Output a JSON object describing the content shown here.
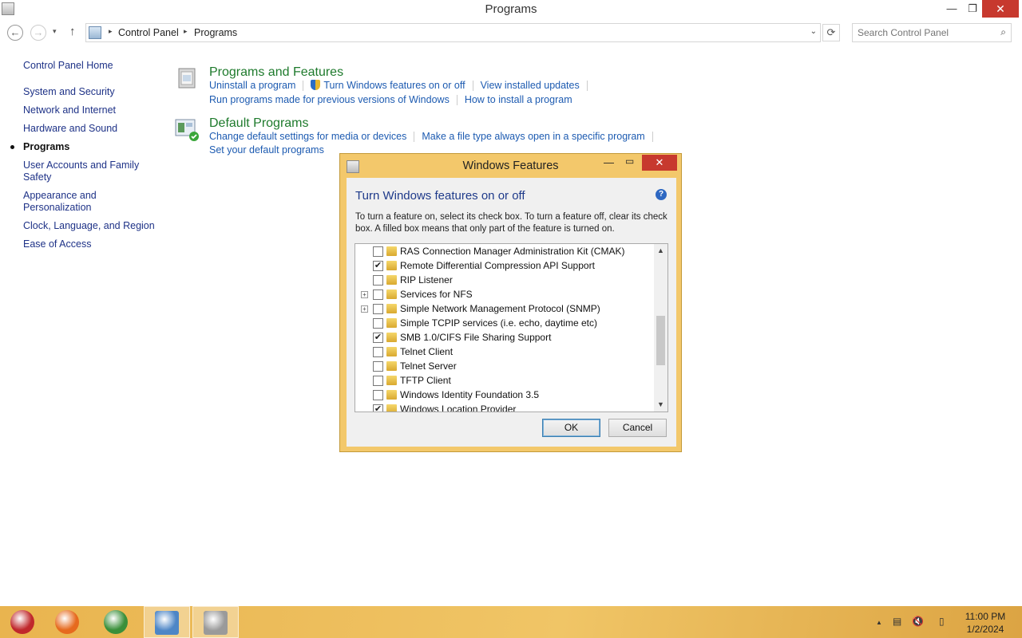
{
  "window": {
    "title": "Programs",
    "min": "—",
    "max": "❐",
    "close": "✕"
  },
  "address": {
    "back": "←",
    "forward": "→",
    "recent": "▾",
    "up": "↑",
    "sep1": "▸",
    "sep2": "▸",
    "crumbs": [
      "Control Panel",
      "Programs"
    ],
    "dropdown": "⌄",
    "refresh": "⟳",
    "search_placeholder": "Search Control Panel",
    "search_icon": "⌕"
  },
  "leftnav": {
    "home": "Control Panel Home",
    "items": [
      "System and Security",
      "Network and Internet",
      "Hardware and Sound",
      "Programs",
      "User Accounts and Family Safety",
      "Appearance and Personalization",
      "Clock, Language, and Region",
      "Ease of Access"
    ],
    "current_index": 3
  },
  "sections": {
    "programs_features": {
      "title": "Programs and Features",
      "links": [
        "Uninstall a program",
        "Turn Windows features on or off",
        "View installed updates",
        "Run programs made for previous versions of Windows",
        "How to install a program"
      ]
    },
    "default_programs": {
      "title": "Default Programs",
      "links": [
        "Change default settings for media or devices",
        "Make a file type always open in a specific program",
        "Set your default programs"
      ]
    }
  },
  "dialog": {
    "title": "Windows Features",
    "min": "—",
    "max": "▭",
    "close": "✕",
    "heading": "Turn Windows features on or off",
    "help": "?",
    "description": "To turn a feature on, select its check box. To turn a feature off, clear its check box. A filled box means that only part of the feature is turned on.",
    "features": [
      {
        "label": "RAS Connection Manager Administration Kit (CMAK)",
        "checked": false,
        "expandable": false
      },
      {
        "label": "Remote Differential Compression API Support",
        "checked": true,
        "expandable": false
      },
      {
        "label": "RIP Listener",
        "checked": false,
        "expandable": false
      },
      {
        "label": "Services for NFS",
        "checked": false,
        "expandable": true
      },
      {
        "label": "Simple Network Management Protocol (SNMP)",
        "checked": false,
        "expandable": true
      },
      {
        "label": "Simple TCPIP services (i.e. echo, daytime etc)",
        "checked": false,
        "expandable": false
      },
      {
        "label": "SMB 1.0/CIFS File Sharing Support",
        "checked": true,
        "expandable": false
      },
      {
        "label": "Telnet Client",
        "checked": false,
        "expandable": false
      },
      {
        "label": "Telnet Server",
        "checked": false,
        "expandable": false
      },
      {
        "label": "TFTP Client",
        "checked": false,
        "expandable": false
      },
      {
        "label": "Windows Identity Foundation 3.5",
        "checked": false,
        "expandable": false
      },
      {
        "label": "Windows Location Provider",
        "checked": true,
        "expandable": false
      }
    ],
    "check_glyph": "✔",
    "expand_glyph": "+",
    "scroll_up": "▲",
    "scroll_down": "▼",
    "ok": "OK",
    "cancel": "Cancel"
  },
  "taskbar": {
    "apps": [
      {
        "name": "ornament-app-icon",
        "color": "#c0282c"
      },
      {
        "name": "firefox-icon",
        "color": "#e66a1e"
      },
      {
        "name": "chrome-icon",
        "color": "#3a8f3a"
      },
      {
        "name": "control-panel-icon",
        "color": "#4d86c6"
      },
      {
        "name": "programs-window-icon",
        "color": "#9a9a9a"
      }
    ],
    "tray": {
      "chevron": "▲",
      "network": "▤",
      "volume": "🔇",
      "power": "▯"
    },
    "clock": {
      "time": "11:00 PM",
      "date": "1/2/2024"
    }
  },
  "colors": {
    "accent_title": "#1e7a2c",
    "link": "#1d5bb1",
    "dialog_frame": "#f3c86b",
    "close_red": "#c7392e"
  }
}
